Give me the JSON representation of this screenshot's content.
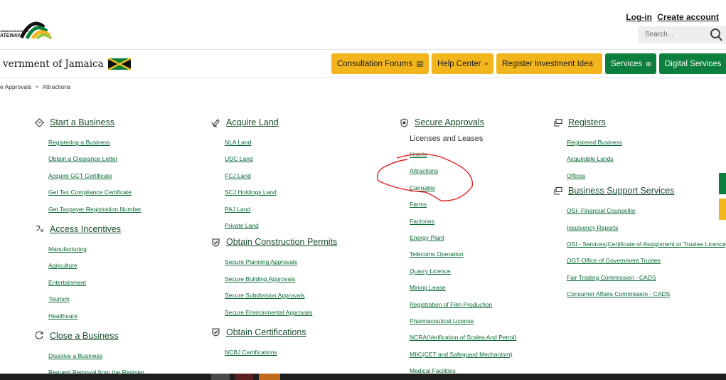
{
  "header": {
    "logo_text_small": "JAMAICA BUSINESS",
    "logo_text": "ATEWAY",
    "login": "Log-in",
    "create_account": "Create account",
    "search_placeholder": "Search..."
  },
  "nav": {
    "gov_title": "vernment of Jamaica",
    "buttons": {
      "consultation": "Consultation Forums",
      "help": "Help Center",
      "register_idea": "Register Investment Idea",
      "services": "Services",
      "digital": "Digital Services"
    }
  },
  "breadcrumb": {
    "parent": "e Approvals",
    "current": "Attractions"
  },
  "columns": {
    "start_business": {
      "title": "Start a Business",
      "links": [
        "Registering a Business",
        "Obtain a Clearance Letter",
        "Acquire GCT Certificate",
        "Get Tax Compliance Certificate",
        "Get Taxpayer Registration Number"
      ]
    },
    "access_incentives": {
      "title": "Access Incentives",
      "links": [
        "Manufacturing",
        "Agriculture",
        "Entertainment",
        "Tourism",
        "Healthcare"
      ]
    },
    "close_business": {
      "title": "Close a Business",
      "links": [
        "Dissolve a Business",
        "Request Removal from the Register"
      ]
    },
    "acquire_land": {
      "title": "Acquire Land",
      "links": [
        "NLA Land",
        "UDC Land",
        "FCJ Land",
        "SCJ Holdings Land",
        "PAJ Land",
        "Private Land"
      ]
    },
    "construction_permits": {
      "title": "Obtain Construction Permits",
      "links": [
        "Secure Planning Approvals",
        "Secure Building Approvals",
        "Secure Subdivision Approvals",
        "Secure Environmental Approvals"
      ]
    },
    "certifications": {
      "title": "Obtain Certifications",
      "links": [
        "NCBJ Certifications"
      ]
    },
    "secure_approvals": {
      "title": "Secure Approvals",
      "subtitle": "Licenses and Leases",
      "links": [
        "Hotels",
        "Attractions",
        "Cannabis",
        "Farms",
        "Factories",
        "Energy Plant",
        "Telecoms Operation",
        "Quarry Licence",
        "Mining Lease",
        "Registration of Film Production",
        "Pharmaceutical License",
        "NCRA(Verification of Scales And Petrol)",
        "MIIC(CET and Safeguard Mechanism)",
        "Medical Facilities"
      ]
    },
    "registers": {
      "title": "Registers",
      "links": [
        "Registered Business",
        "Acquirable Lands",
        "Offices"
      ]
    },
    "support_services": {
      "title": "Business Support Services",
      "links": [
        "OSI- Financial Counsellor",
        "Insolvency Reports",
        "OSI - Services(Certificate of Assignment or Trustee Licence)",
        "OGT-Office of Government Trustee",
        "Fair Trading Commission - CADS",
        "Consumer Affairs Commission - CADS"
      ]
    }
  },
  "colors": {
    "yellow": "#f2b51c",
    "green": "#0b7f3b",
    "link": "#0b6a34",
    "annotation": "#e02020"
  }
}
